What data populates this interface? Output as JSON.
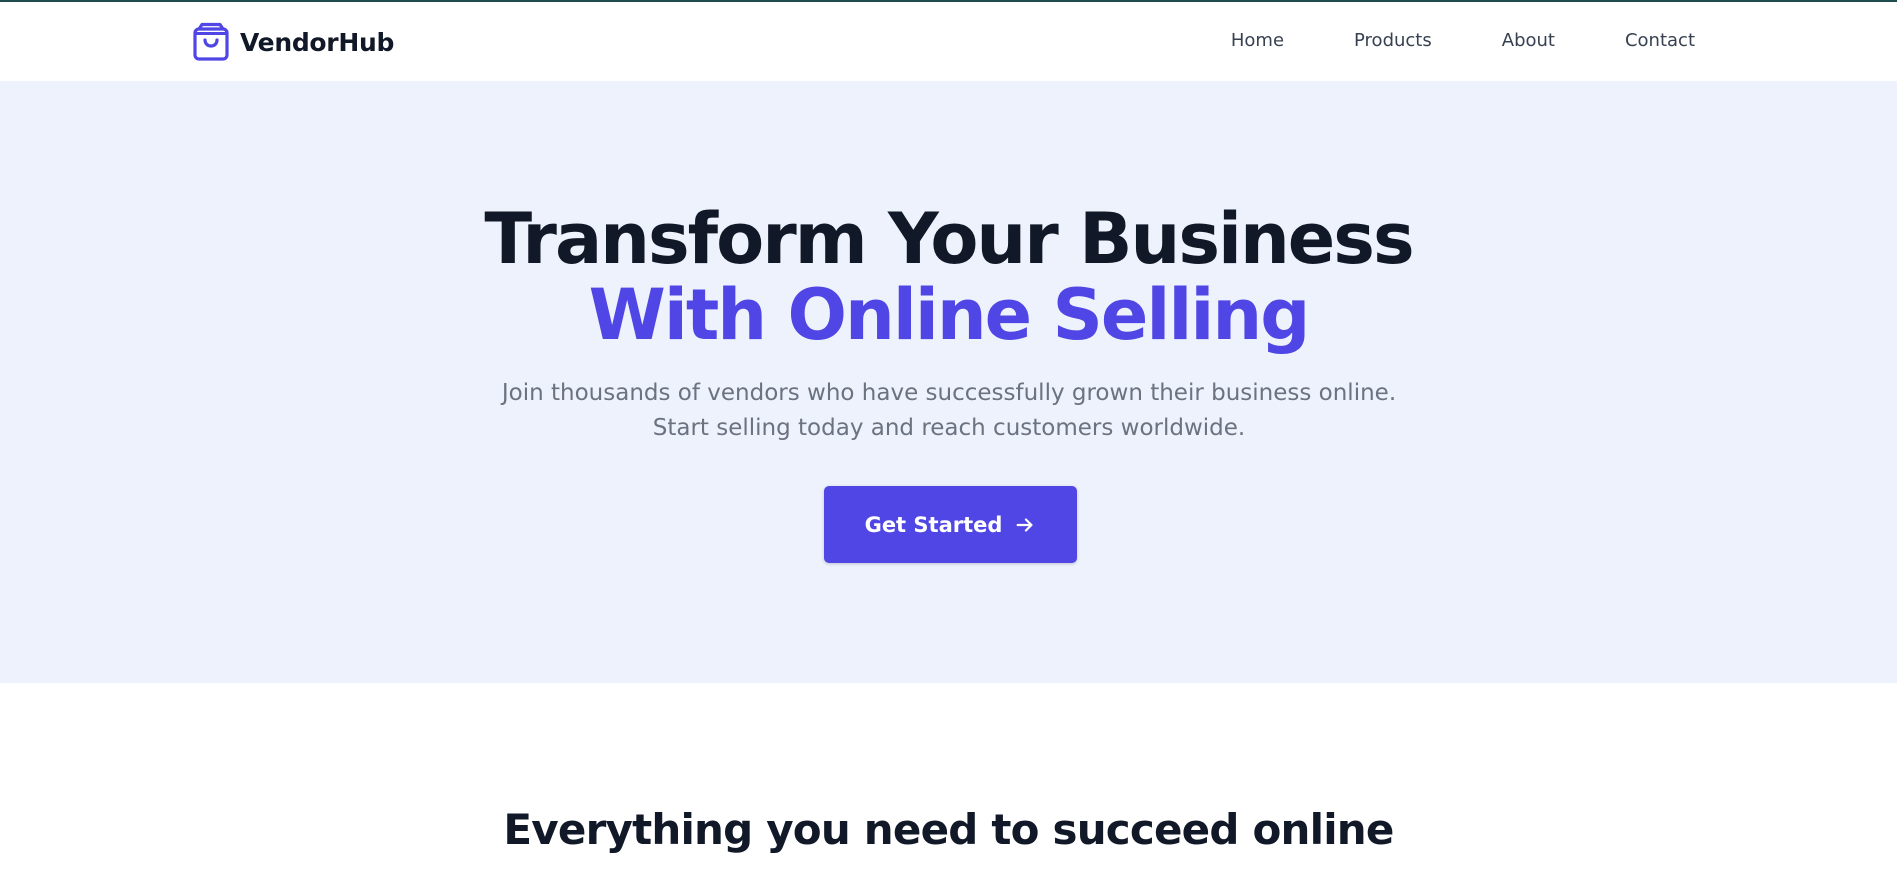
{
  "brand": {
    "name": "VendorHub",
    "icon": "shopping-bag-icon",
    "icon_color": "#4f46e5"
  },
  "nav": {
    "items": [
      {
        "label": "Home"
      },
      {
        "label": "Products"
      },
      {
        "label": "About"
      },
      {
        "label": "Contact"
      }
    ]
  },
  "hero": {
    "title_line1": "Transform Your Business",
    "title_line2": "With Online Selling",
    "subtitle": "Join thousands of vendors who have successfully grown their business online. Start selling today and reach customers worldwide.",
    "cta_label": "Get Started",
    "cta_icon": "arrow-right-icon",
    "accent_color": "#4f46e5",
    "background_color": "#eef2fd"
  },
  "features": {
    "title": "Everything you need to succeed online"
  }
}
